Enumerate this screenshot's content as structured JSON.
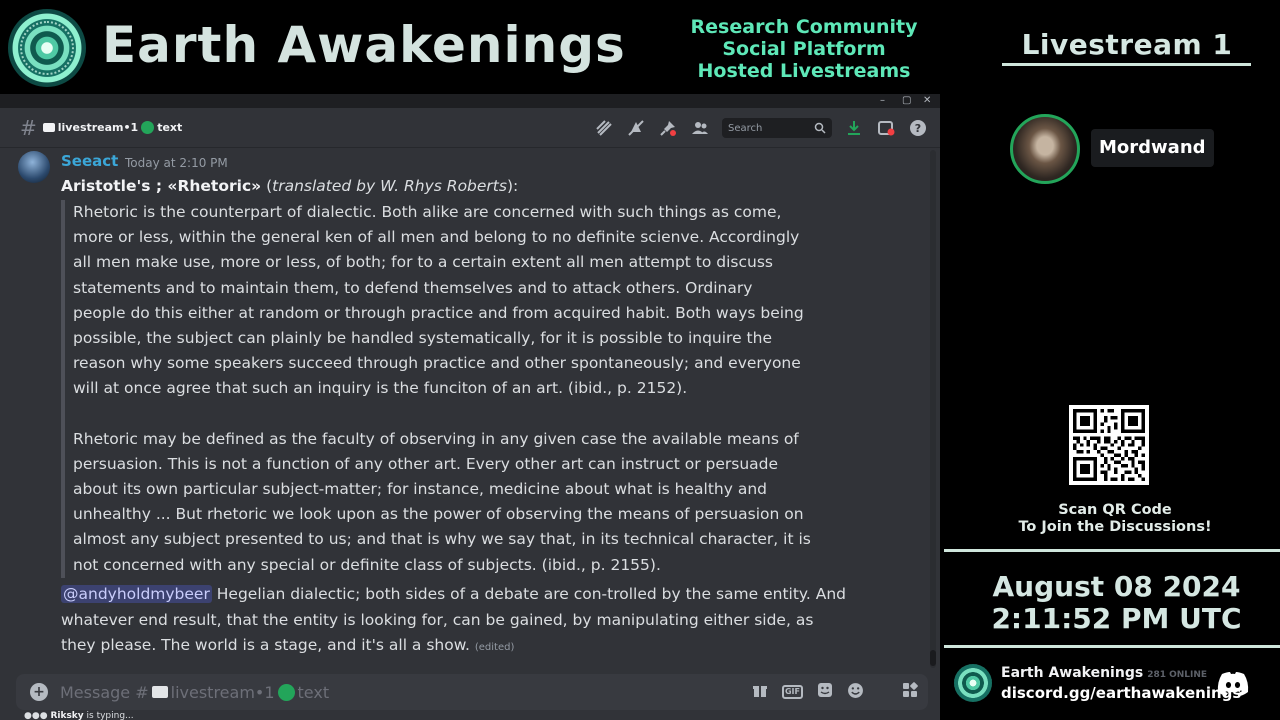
{
  "banner": {
    "title": "Earth Awakenings",
    "tagline": [
      "Research Community",
      "Social Platform",
      "Hosted Livestreams"
    ]
  },
  "window": {
    "controls": {
      "minimize": "–",
      "maximize": "▢",
      "close": "✕"
    },
    "channel": {
      "hash": "#",
      "name_prefix": "livestream•1",
      "name_suffix": "text"
    },
    "search": {
      "placeholder": "Search"
    }
  },
  "message": {
    "author": "Seeact",
    "timestamp": "Today at 2:10 PM",
    "lead_bold": "Aristotle's ; «Rhetoric»",
    "lead_italic": "translated by W. Rhys Roberts",
    "lead_end": "):",
    "quote_paragraphs": [
      "Rhetoric is the counterpart of dialectic. Both alike are concerned with such things as come,\nmore or less, within the general ken of all men and belong to no definite scienve. Accordingly\nall men make use, more or less, of both; for to a certain extent all men attempt to discuss\nstatements and to maintain them, to defend themselves and to attack others. Ordinary\npeople do this either at random or through practice and from acquired habit. Both ways being\npossible, the subject can plainly be handled systematically, for it is possible to inquire the\nreason why some speakers succeed through practice and other spontaneously; and everyone\nwill at once agree that such an inquiry is the funciton of an art. (ibid., p. 2152).",
      "Rhetoric may be defined as the faculty of observing in any given case the available means of\npersuasion. This is not a function of any other art. Every other art can instruct or persuade\nabout its own particular subject-matter; for instance, medicine about what is healthy and\nunhealthy ... But rhetoric we look upon as the power of observing the means of persuasion on\nalmost any subject presented to us; and that is why we say that, in its technical character, it is\nnot concerned with any special or definite class of subjects. (ibid., p. 2155)."
    ],
    "mention": "@andyholdmybeer",
    "reply_text": " Hegelian dialectic; both sides of a debate are con-trolled by the same entity. And whatever end result, that the entity is looking for, can be gained, by manipulating either side, as they please. The world is a stage, and it's all a show. ",
    "edited": "(edited)"
  },
  "composer": {
    "placeholder_prefix": "Message #",
    "placeholder_channel": "livestream•1",
    "placeholder_suffix": "text",
    "typing_user": "Riksky",
    "typing_text": " is typing..."
  },
  "right_panel": {
    "livestream_title": "Livestream 1",
    "speaker_name": "Mordwand",
    "qr_caption": [
      "Scan QR Code",
      "To Join the Discussions!"
    ],
    "date": "August 08 2024",
    "time": "2:11:52 PM UTC",
    "widget": {
      "server_name": "Earth Awakenings",
      "online": "281 ONLINE",
      "invite": "discord.gg/earthawakenings"
    }
  },
  "colors": {
    "accent_teal": "#5ee8b8",
    "author_blue": "#3ba7d8",
    "status_green": "#23a55a",
    "discord_bg": "#313338"
  }
}
